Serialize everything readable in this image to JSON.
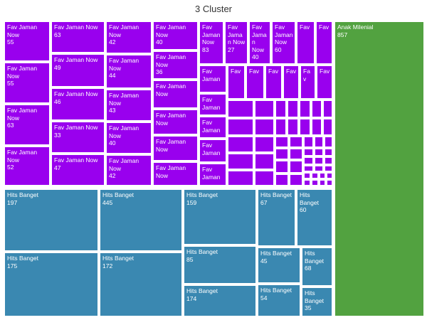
{
  "chart_data": {
    "type": "treemap",
    "title": "3 Cluster",
    "colors": {
      "Fav Jaman Now": "#9900ee",
      "Hits Banget": "#3a88b1",
      "Anak Milenial": "#52a240"
    },
    "groups": [
      {
        "name": "Fav Jaman Now",
        "items": [
          {
            "label": "Fav Jaman Now",
            "value": 55
          },
          {
            "label": "Fav Jaman Now",
            "value": 55
          },
          {
            "label": "Fav Jaman Now",
            "value": 63
          },
          {
            "label": "Fav Jaman Now",
            "value": 52
          },
          {
            "label": "Fav Jaman Now",
            "value": 63
          },
          {
            "label": "Fav Jaman Now",
            "value": 49
          },
          {
            "label": "Fav Jaman Now",
            "value": 46
          },
          {
            "label": "Fav Jaman Now",
            "value": 33
          },
          {
            "label": "Fav Jaman Now",
            "value": 47
          },
          {
            "label": "Fav Jaman Now",
            "value": 42
          },
          {
            "label": "Fav Jaman Now",
            "value": 44
          },
          {
            "label": "Fav Jaman Now",
            "value": 43
          },
          {
            "label": "Fav Jaman Now",
            "value": 40
          },
          {
            "label": "Fav Jaman Now",
            "value": 42
          },
          {
            "label": "Fav Jaman Now",
            "value": 40
          },
          {
            "label": "Fav Jaman Now",
            "value": 36
          },
          {
            "label": "Fav Jaman Now",
            "value": null
          },
          {
            "label": "Fav Jaman Now",
            "value": null
          },
          {
            "label": "Fav Jaman Now",
            "value": null
          },
          {
            "label": "Fav Jaman Now",
            "value": null
          },
          {
            "label": "Fav Jaman Now",
            "value": 83
          },
          {
            "label": "Fav Jaman Now",
            "value": 27
          },
          {
            "label": "Fav Jaman Now",
            "value": 40
          },
          {
            "label": "Fav Jaman Now",
            "value": 60
          },
          {
            "label": "Fav",
            "value": null
          },
          {
            "label": "Fav",
            "value": null
          },
          {
            "label": "Fav Jaman",
            "value": null
          },
          {
            "label": "Fav Jaman",
            "value": null
          },
          {
            "label": "Fav Jaman",
            "value": null
          },
          {
            "label": "Fav Jaman",
            "value": null
          },
          {
            "label": "Fav Jaman",
            "value": null
          },
          {
            "label": "Fav Jaman",
            "value": null
          },
          {
            "label": "Fav",
            "value": null
          },
          {
            "label": "Fav",
            "value": null
          },
          {
            "label": "Fav",
            "value": null
          },
          {
            "label": "Fav",
            "value": null
          },
          {
            "label": "Fav",
            "value": null
          },
          {
            "label": "Fav",
            "value": null
          }
        ]
      },
      {
        "name": "Hits Banget",
        "items": [
          {
            "label": "Hits Banget",
            "value": 197
          },
          {
            "label": "Hits Banget",
            "value": 175
          },
          {
            "label": "Hits Banget",
            "value": 445
          },
          {
            "label": "Hits Banget",
            "value": 172
          },
          {
            "label": "Hits Banget",
            "value": 159
          },
          {
            "label": "Hits Banget",
            "value": 85
          },
          {
            "label": "Hits Banget",
            "value": 174
          },
          {
            "label": "Hits Banget",
            "value": 67
          },
          {
            "label": "Hits Banget",
            "value": 60
          },
          {
            "label": "Hits Banget",
            "value": 45
          },
          {
            "label": "Hits Banget",
            "value": 54
          },
          {
            "label": "Hits Banget",
            "value": 68
          },
          {
            "label": "Hits Banget",
            "value": 35
          }
        ]
      },
      {
        "name": "Anak Milenial",
        "items": [
          {
            "label": "Anak Milenial",
            "value": 857
          }
        ]
      }
    ]
  }
}
